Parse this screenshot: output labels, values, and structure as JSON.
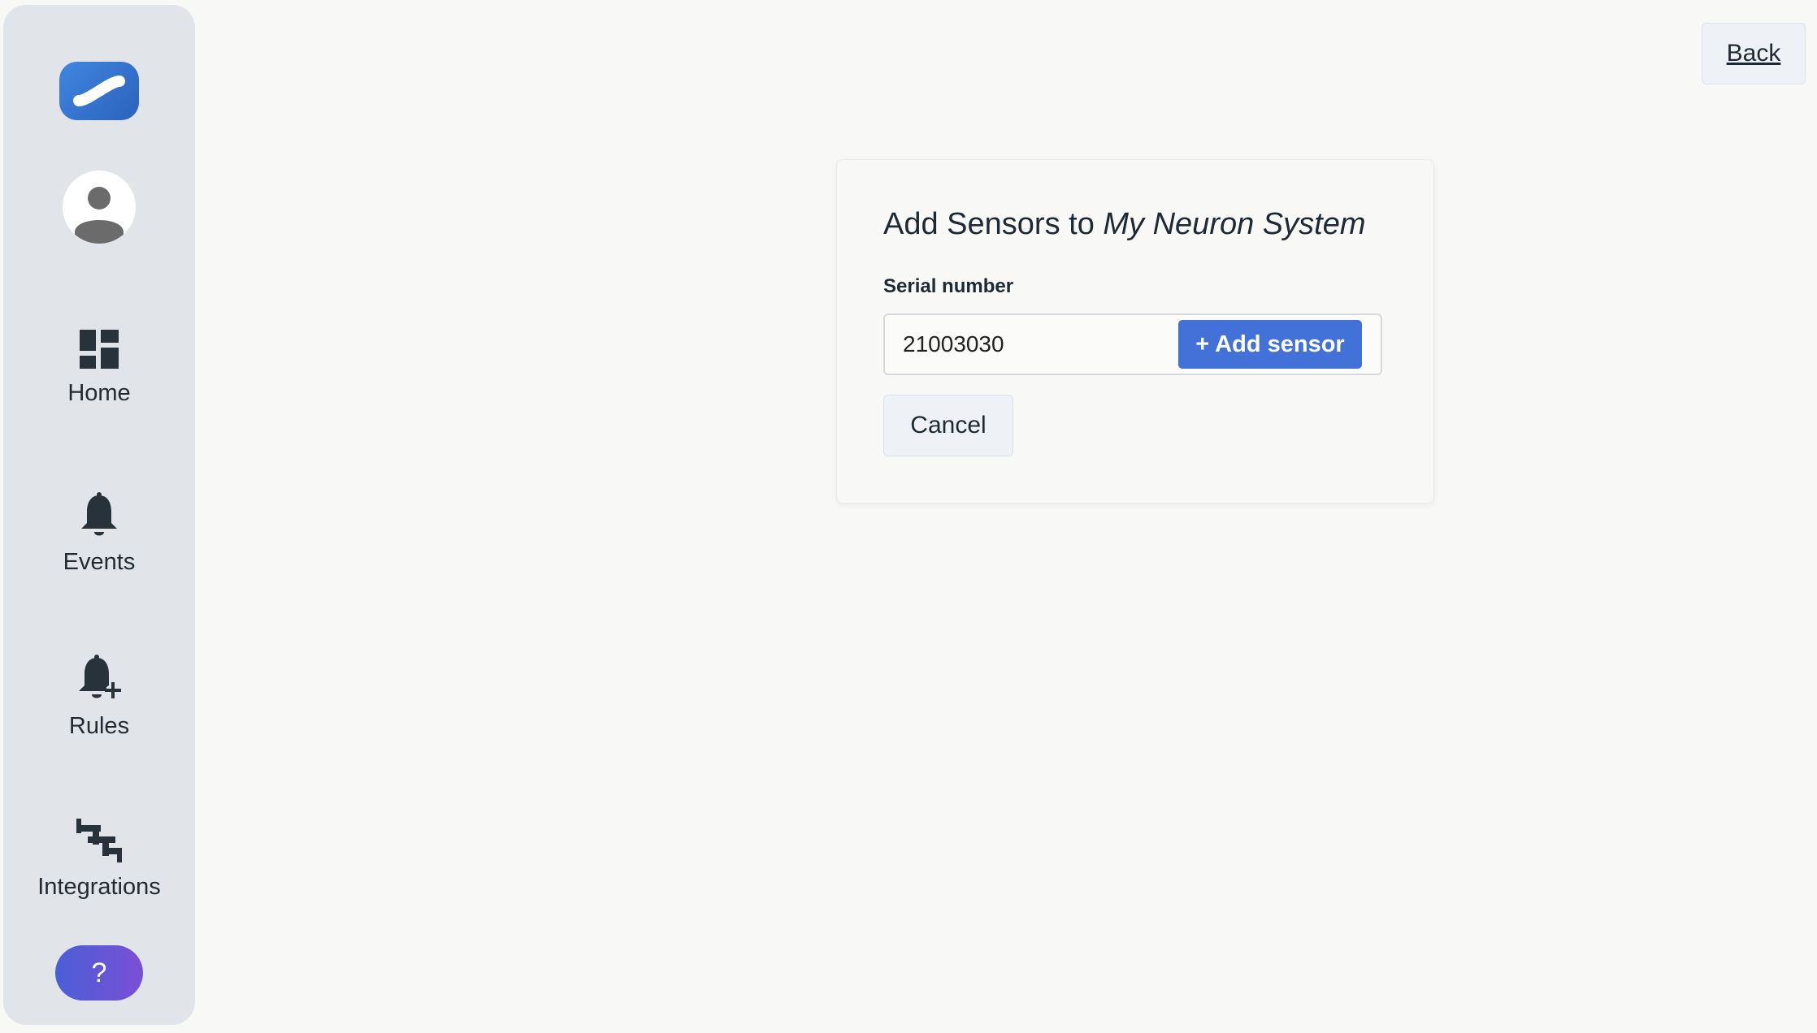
{
  "sidebar": {
    "logo_icon": "link-icon",
    "avatar_icon": "user-icon",
    "items": [
      {
        "label": "Home",
        "icon": "dashboard-icon"
      },
      {
        "label": "Events",
        "icon": "bell-icon"
      },
      {
        "label": "Rules",
        "icon": "bell-plus-icon"
      },
      {
        "label": "Integrations",
        "icon": "integrations-icon"
      }
    ],
    "help_label": "?"
  },
  "header": {
    "back_label": "Back"
  },
  "card": {
    "title_prefix": "Add Sensors to ",
    "title_system": "My Neuron System",
    "serial_label": "Serial number",
    "serial_value": "21003030",
    "add_label": "+ Add sensor",
    "cancel_label": "Cancel"
  },
  "colors": {
    "accent": "#4271d8",
    "sidebar_bg": "#e1e5ea",
    "page_bg": "#f8f8f6"
  }
}
